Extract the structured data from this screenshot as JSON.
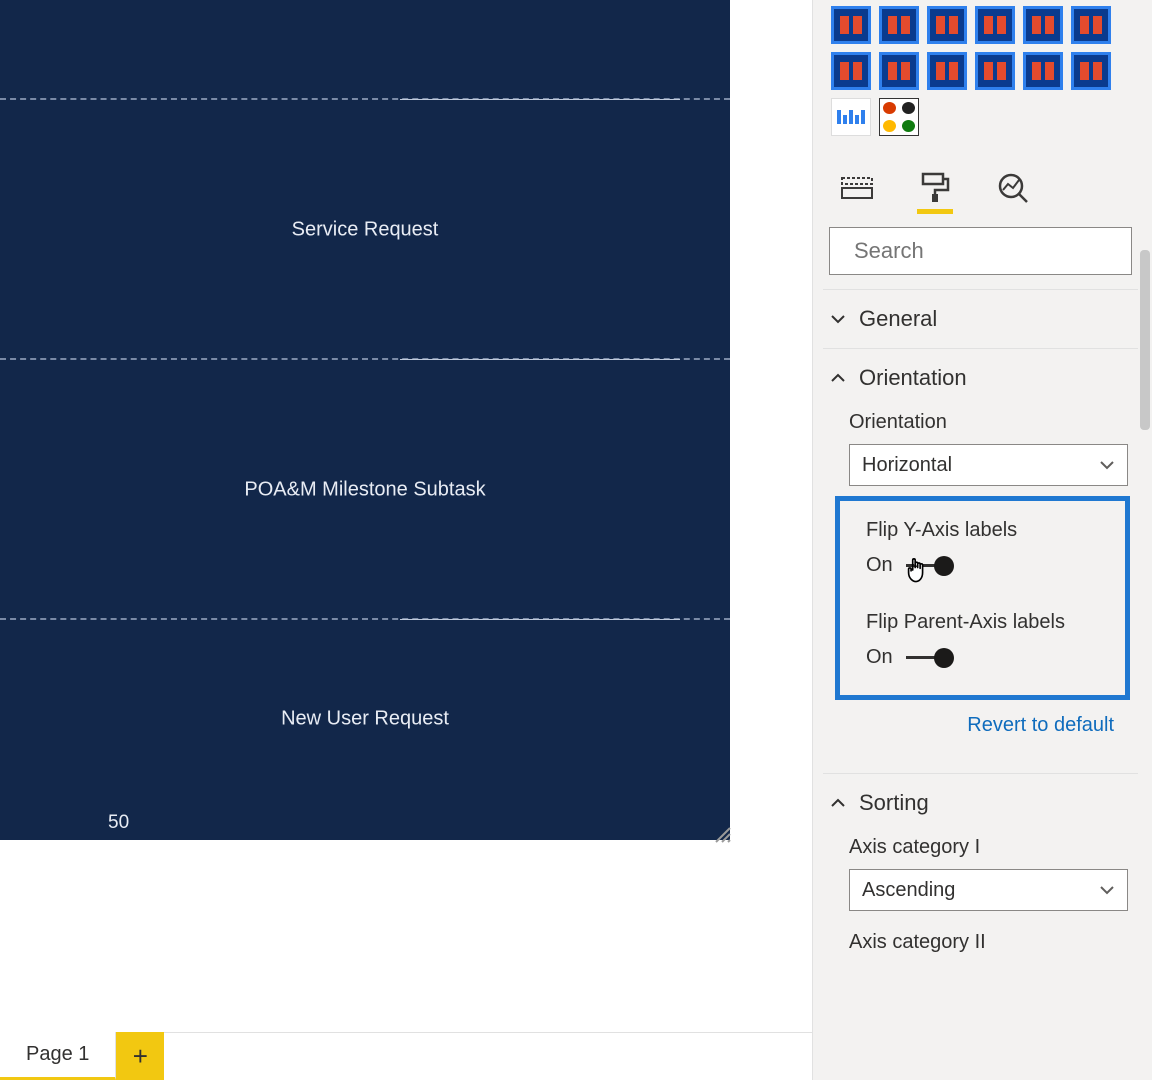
{
  "canvas": {
    "rows": [
      {
        "label": "Service Request"
      },
      {
        "label": "POA&M Milestone Subtask"
      },
      {
        "label": "New User Request"
      }
    ],
    "x_tick": "50"
  },
  "page_tabs": {
    "active": "Page 1",
    "add_tooltip": "+"
  },
  "pane": {
    "search": {
      "placeholder": "Search"
    },
    "sections": {
      "general": {
        "title": "General",
        "expanded": false
      },
      "orientation": {
        "title": "Orientation",
        "expanded": true,
        "field_label": "Orientation",
        "selected": "Horizontal",
        "flip_y_label": "Flip Y-Axis labels",
        "flip_y_state": "On",
        "flip_parent_label": "Flip Parent-Axis labels",
        "flip_parent_state": "On"
      },
      "sorting": {
        "title": "Sorting",
        "expanded": true,
        "axis1_label": "Axis category I",
        "axis1_selected": "Ascending",
        "axis2_label": "Axis category II"
      }
    },
    "revert_label": "Revert to default"
  }
}
